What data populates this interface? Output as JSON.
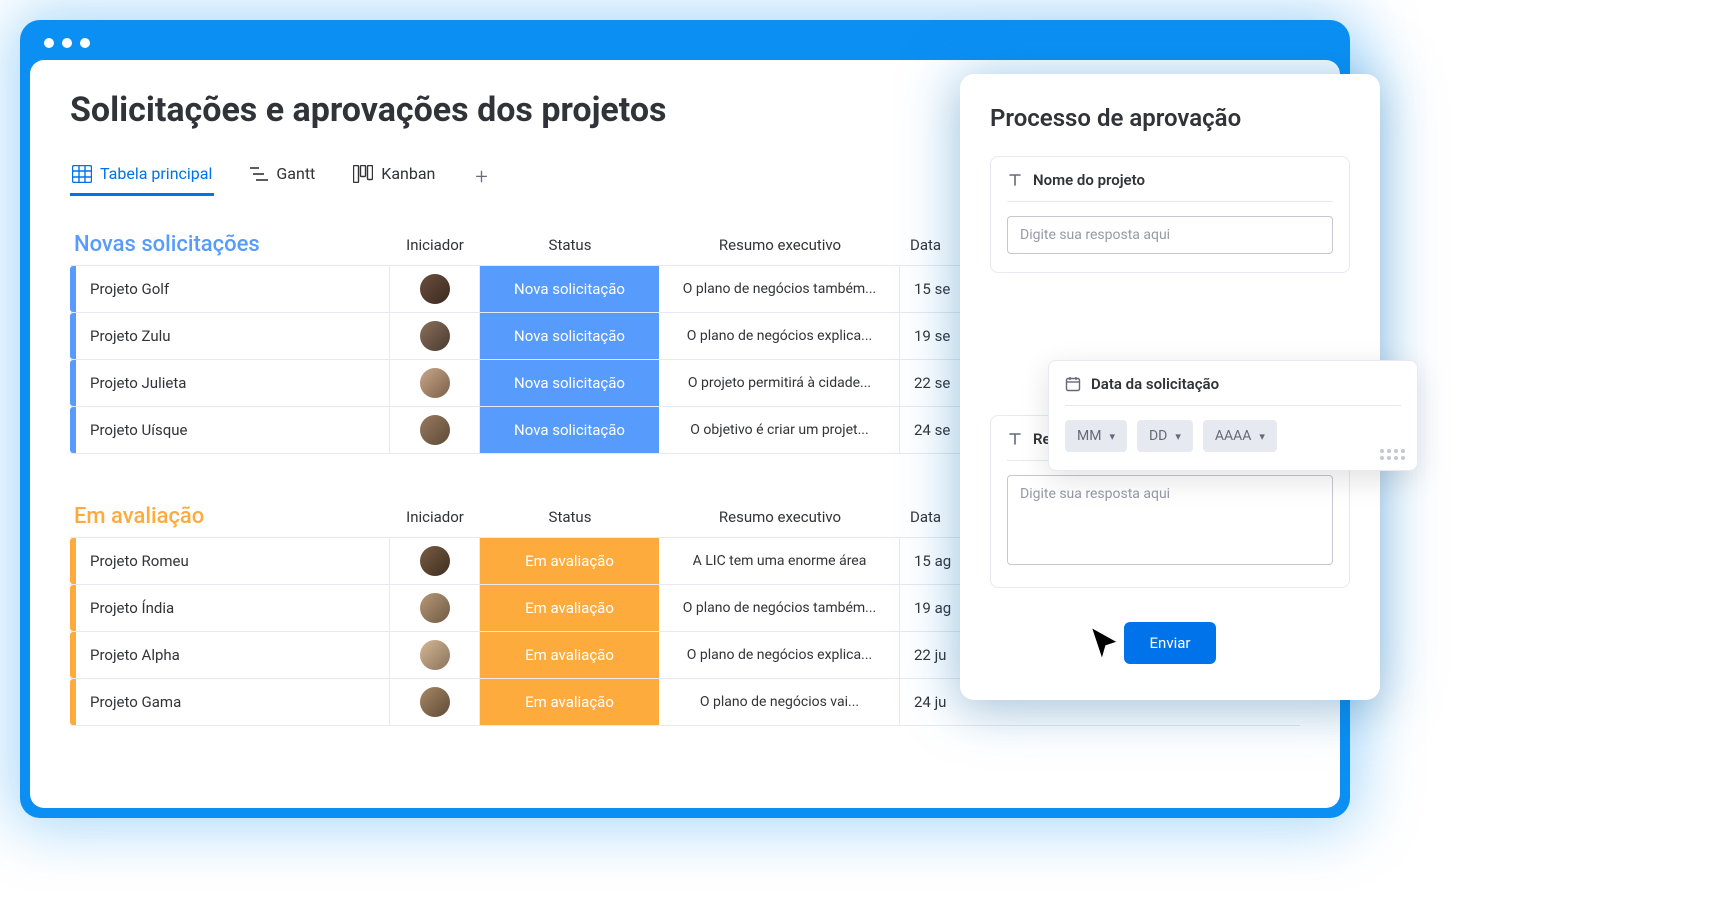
{
  "header": {
    "title": "Solicitações e aprovações dos projetos"
  },
  "tabs": {
    "main": "Tabela principal",
    "gantt": "Gantt",
    "kanban": "Kanban"
  },
  "columns": {
    "iniciador": "Iniciador",
    "status": "Status",
    "resumo": "Resumo executivo",
    "data": "Data"
  },
  "groups": {
    "novas": {
      "title": "Novas solicitações",
      "status_label": "Nova solicitação",
      "rows": [
        {
          "name": "Projeto Golf",
          "resumo": "O plano de negócios também...",
          "data": "15 se"
        },
        {
          "name": "Projeto Zulu",
          "resumo": "O plano de negócios explica...",
          "data": "19 se"
        },
        {
          "name": "Projeto Julieta",
          "resumo": "O projeto permitirá à cidade...",
          "data": "22 se"
        },
        {
          "name": "Projeto Uísque",
          "resumo": "O objetivo é criar um projet...",
          "data": "24 se"
        }
      ]
    },
    "avaliacao": {
      "title": "Em avaliação",
      "status_label": "Em avaliação",
      "rows": [
        {
          "name": "Projeto Romeu",
          "resumo": "A LIC tem uma enorme área",
          "data": "15 ag"
        },
        {
          "name": "Projeto Índia",
          "resumo": "O plano de negócios também...",
          "data": "19 ag"
        },
        {
          "name": "Projeto Alpha",
          "resumo": "O plano de negócios explica...",
          "data": "22 ju"
        },
        {
          "name": "Projeto Gama",
          "resumo": "O plano de negócios vai...",
          "data": "24 ju"
        }
      ]
    }
  },
  "panel": {
    "title": "Processo de aprovação",
    "fields": {
      "project_name_label": "Nome do projeto",
      "project_name_placeholder": "Digite sua resposta aqui",
      "date_label": "Data da solicitação",
      "date_mm": "MM",
      "date_dd": "DD",
      "date_yyyy": "AAAA",
      "resumo_label": "Resumo executivo",
      "resumo_placeholder": "Digite sua resposta aqui"
    },
    "submit": "Enviar"
  }
}
